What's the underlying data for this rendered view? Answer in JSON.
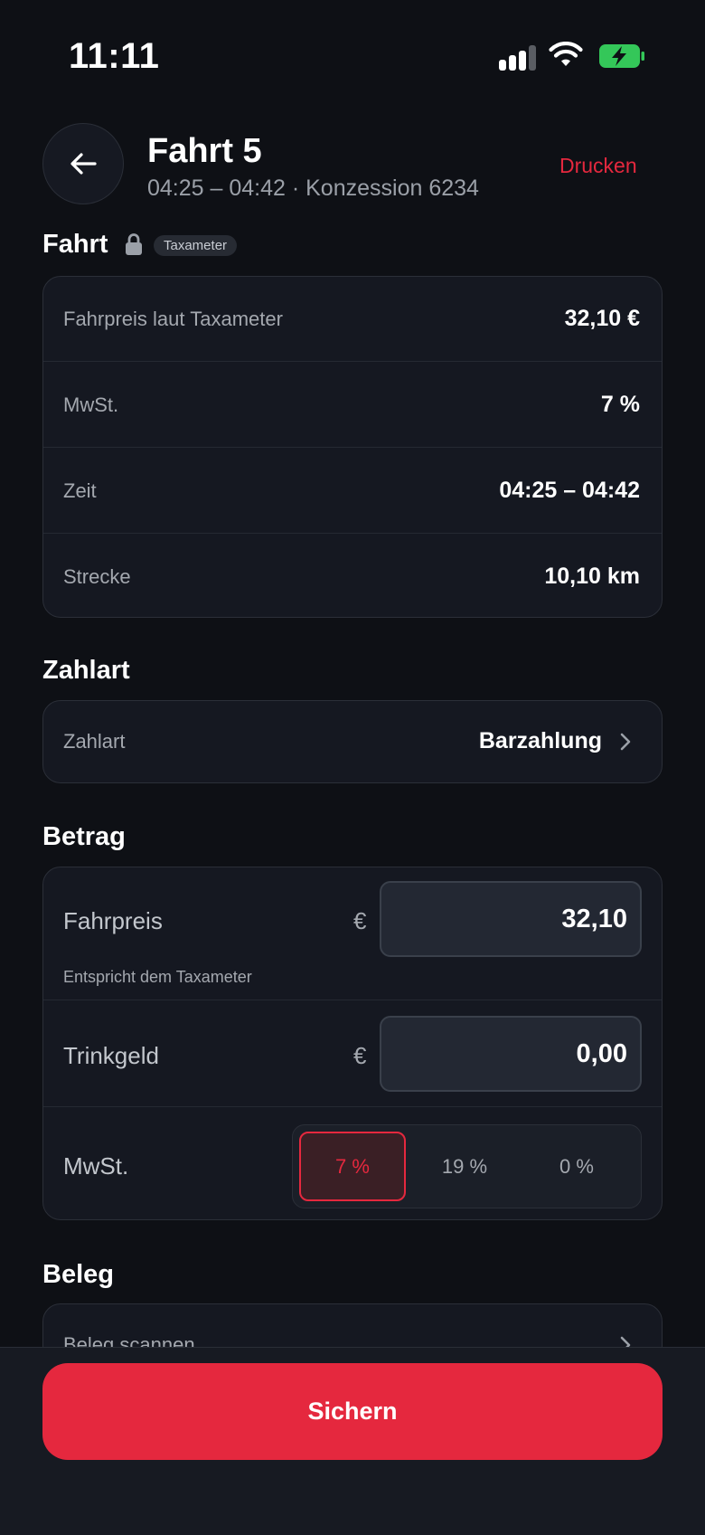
{
  "status_bar": {
    "time": "11:11",
    "signal_bars": 3,
    "signal_total": 4,
    "battery_charging": true
  },
  "header": {
    "title": "Fahrt 5",
    "subtitle": "04:25 – 04:42 · Konzession 6234",
    "print_label": "Drucken"
  },
  "ride": {
    "title": "Fahrt",
    "badge": "Taxameter",
    "rows": [
      {
        "label": "Fahrpreis laut Taxameter",
        "value": "32,10 €"
      },
      {
        "label": "MwSt.",
        "value": "7 %"
      },
      {
        "label": "Zeit",
        "value": "04:25 – 04:42"
      },
      {
        "label": "Strecke",
        "value": "10,10 km"
      }
    ]
  },
  "payment": {
    "title": "Zahlart",
    "label": "Zahlart",
    "value": "Barzahlung"
  },
  "amount": {
    "title": "Betrag",
    "fare_label": "Fahrpreis",
    "fare_currency": "€",
    "fare_value": "32,10",
    "fare_hint": "Entspricht dem Taxameter",
    "tip_label": "Trinkgeld",
    "tip_currency": "€",
    "tip_value": "0,00",
    "vat_label": "MwSt.",
    "vat_options": [
      "7 %",
      "19 %",
      "0 %"
    ],
    "vat_selected": "7 %"
  },
  "receipt": {
    "title": "Beleg",
    "scan_label": "Beleg scannen"
  },
  "footer": {
    "save_label": "Sichern"
  },
  "colors": {
    "accent": "#e5283e",
    "background": "#0e1015",
    "card": "#151821"
  }
}
